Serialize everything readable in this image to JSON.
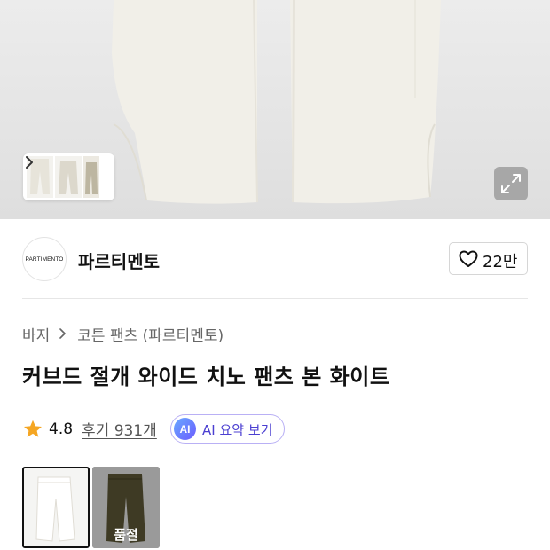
{
  "product_image": {
    "expand_icon": "expand-icon",
    "thumbnail_next_icon": "chevron-right-icon"
  },
  "brand": {
    "logo_text": "PARTIMENTO",
    "name": "파르티멘토",
    "like_icon": "heart-outline-icon",
    "like_count": "22만"
  },
  "breadcrumb": {
    "items": [
      "바지",
      "코튼 팬츠 (파르티멘토)"
    ],
    "separator_icon": "chevron-right-icon"
  },
  "product": {
    "title": "커브드 절개 와이드 치노 팬츠 본 화이트"
  },
  "rating": {
    "star_icon": "star-icon",
    "value": "4.8",
    "review_text": "후기 931개",
    "ai_badge": "AI",
    "ai_summary_label": "AI 요약 보기"
  },
  "color_options": [
    {
      "swatch": "#f3f2ee",
      "selected": true
    },
    {
      "swatch": "#3e3a24",
      "selected": false,
      "status": "품절"
    }
  ],
  "colors": {
    "star": "#f5a623",
    "ai_border": "#b9b0f5",
    "ai_text": "#4b3fd1"
  }
}
